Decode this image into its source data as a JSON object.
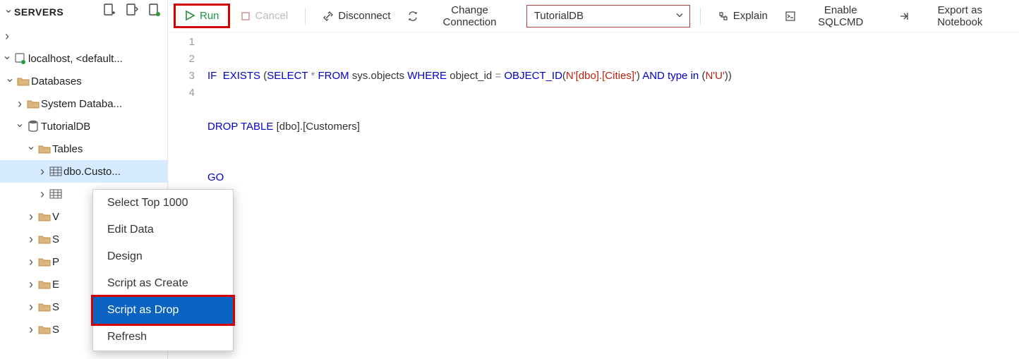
{
  "sidebar": {
    "title": "SERVERS",
    "nodes": {
      "localhost": "localhost, <default...",
      "databases": "Databases",
      "sysdb": "System Databa...",
      "tutorialdb": "TutorialDB",
      "tables": "Tables",
      "custo": "dbo.Custo...",
      "v": "V",
      "s1": "S",
      "p": "P",
      "e": "E",
      "s2": "S",
      "s3": "S"
    }
  },
  "toolbar": {
    "run": "Run",
    "cancel": "Cancel",
    "disconnect": "Disconnect",
    "change_conn": "Change Connection",
    "db_selected": "TutorialDB",
    "explain": "Explain",
    "enable_sqlcmd": "Enable SQLCMD",
    "export_nb": "Export as Notebook"
  },
  "editor": {
    "line_numbers": [
      "1",
      "2",
      "3",
      "4"
    ],
    "code": {
      "l1": {
        "k_if": "IF",
        "k_exists": "EXISTS",
        "k_select": "SELECT",
        "star": "*",
        "k_from": "FROM",
        "sysobj": "sys.objects",
        "k_where": "WHERE",
        "objid": "object_id",
        "eq": "=",
        "fn_oid": "OBJECT_ID",
        "prefix1": "N",
        "lit1": "'[dbo].[Cities]'",
        "k_and": "AND",
        "k_type": "type",
        "k_in": "in",
        "prefix2": "N",
        "lit2": "'U'"
      },
      "l2": {
        "k_drop": "DROP",
        "k_table": "TABLE",
        "tbl": "[dbo].[Customers]"
      },
      "l3": {
        "go": "GO"
      }
    }
  },
  "context_menu": {
    "items": {
      "select_top": "Select Top 1000",
      "edit_data": "Edit Data",
      "design": "Design",
      "script_create": "Script as Create",
      "script_drop": "Script as Drop",
      "refresh": "Refresh"
    }
  }
}
